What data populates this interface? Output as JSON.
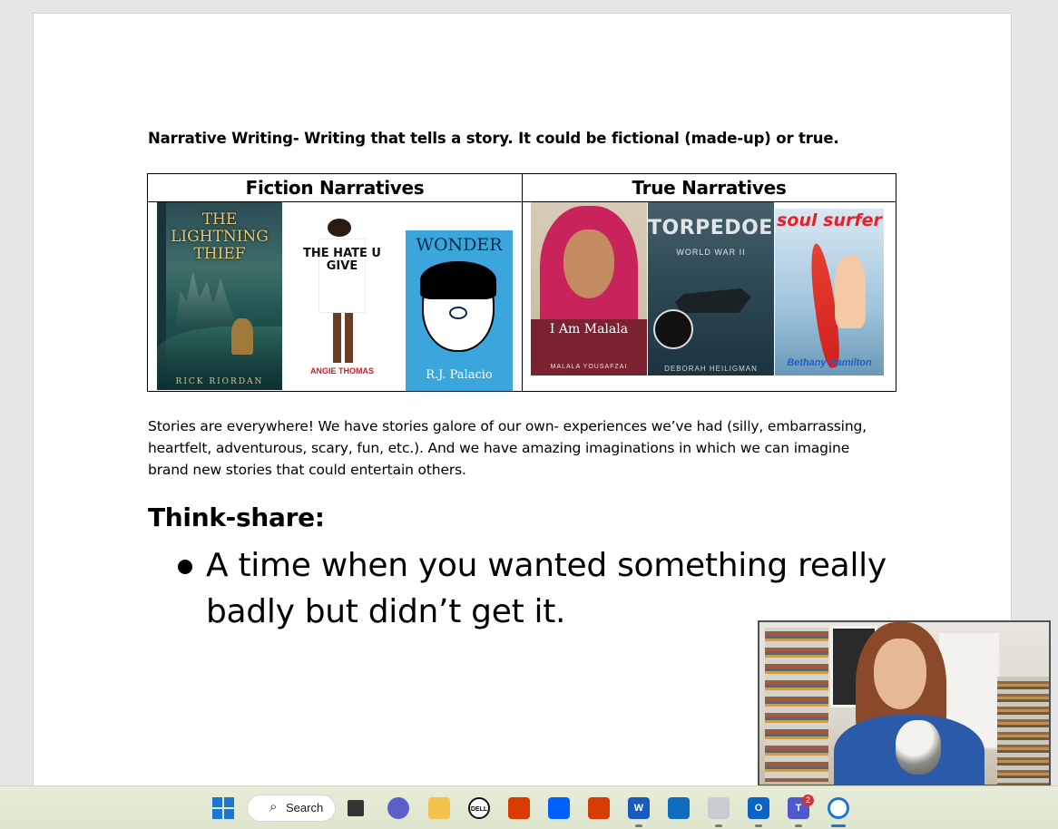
{
  "document": {
    "title": "Narrative Writing- Writing that tells a story. It could be fictional (made-up) or true.",
    "table": {
      "headers": [
        "Fiction Narratives",
        "True Narratives"
      ],
      "fiction_books": [
        {
          "title": "THE LIGHTNING THIEF",
          "author": "RICK RIORDAN"
        },
        {
          "title": "THE HATE U GIVE",
          "author": "ANGIE THOMAS"
        },
        {
          "title": "WONDER",
          "author": "R.J. Palacio"
        }
      ],
      "true_books": [
        {
          "title": "I Am Malala",
          "author": "MALALA YOUSAFZAI"
        },
        {
          "title": "TORPEDOED",
          "subtitle": "WORLD WAR II",
          "author": "DEBORAH HEILIGMAN"
        },
        {
          "title": "soul surfer",
          "author": "Bethany Hamilton"
        }
      ]
    },
    "paragraph_lines": [
      "Stories are everywhere! We have stories galore of our own- experiences we’ve had (silly, embarrassing,",
      "heartfelt, adventurous, scary, fun, etc.). And we have amazing imaginations in which we can imagine",
      "brand new stories that could entertain others."
    ],
    "think_heading": "Think-share:",
    "bullet_lines": [
      "A time when you wanted something really",
      "badly but didn’t get it."
    ]
  },
  "taskbar": {
    "search_label": "Search",
    "teams_badge": "2",
    "icons": [
      "windows-start-icon",
      "search-icon",
      "task-view-icon",
      "video-chat-icon",
      "file-explorer-icon",
      "dell-icon",
      "office-icon",
      "dropbox-icon",
      "office-icon",
      "word-icon",
      "mail-icon",
      "onedrive-icon",
      "outlook-icon",
      "teams-icon",
      "cortana-icon"
    ]
  },
  "colors": {
    "page": "#ffffff",
    "background": "#e6e6e6",
    "taskbar": "#e2e8d2",
    "accent": "#1a78d4"
  }
}
